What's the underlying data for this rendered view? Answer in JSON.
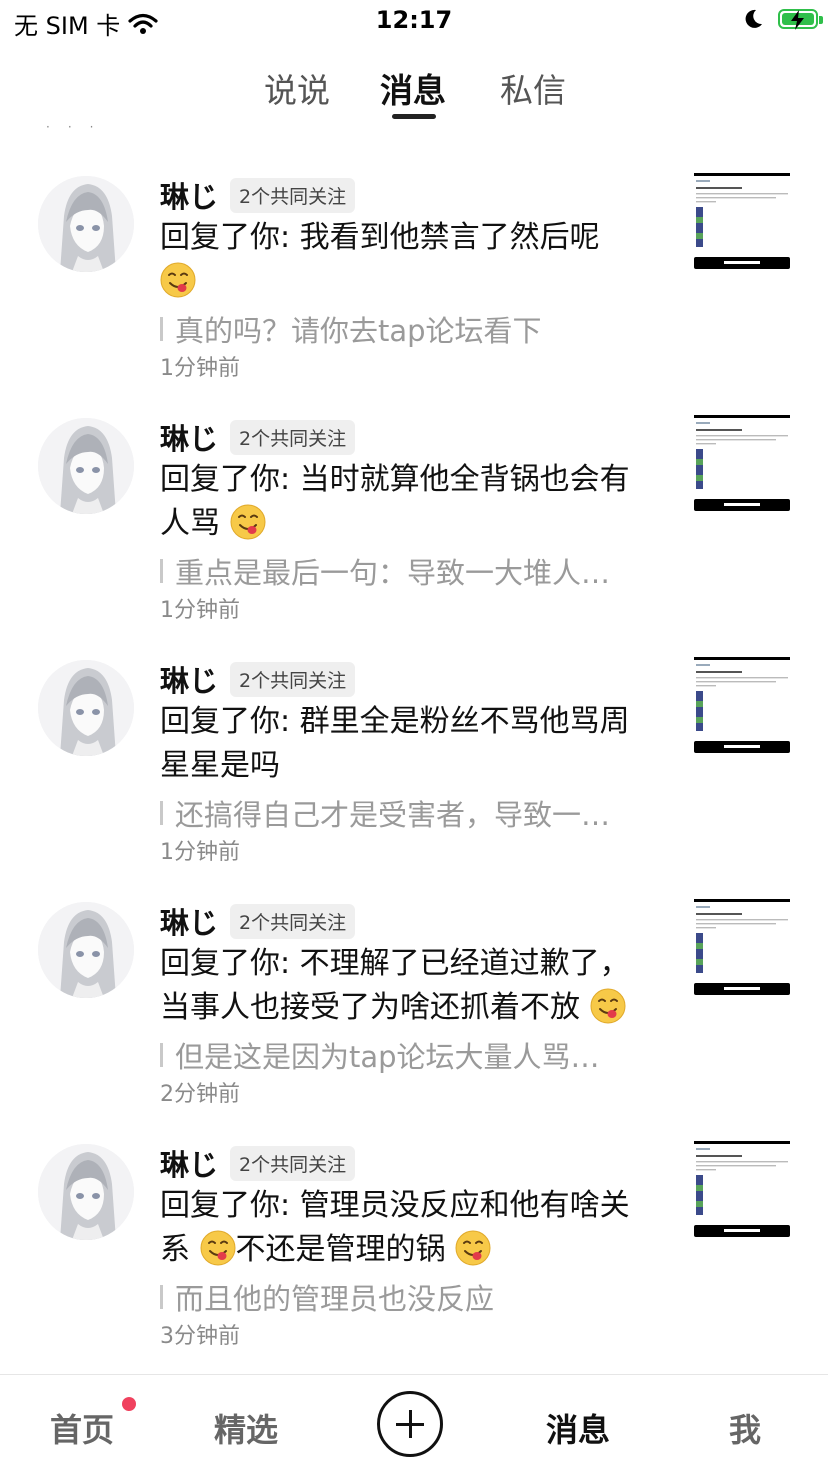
{
  "status_bar": {
    "carrier": "无 SIM 卡",
    "time": "12:17"
  },
  "top_tabs": [
    {
      "label": "说说",
      "active": false
    },
    {
      "label": "消息",
      "active": true
    },
    {
      "label": "私信",
      "active": false
    }
  ],
  "messages": [
    {
      "name": "琳じ",
      "badge": "2个共同关注",
      "segments": [
        {
          "t": "回复了你: 我看到他禁言了然后呢"
        },
        {
          "e": "face-savoring-food"
        }
      ],
      "quote": "真的吗？请你去tap论坛看下",
      "time": "1分钟前"
    },
    {
      "name": "琳じ",
      "badge": "2个共同关注",
      "segments": [
        {
          "t": "回复了你: 当时就算他全背锅也会有人骂"
        },
        {
          "e": "face-savoring-food"
        }
      ],
      "quote": "重点是最后一句：导致一大堆人…",
      "time": "1分钟前"
    },
    {
      "name": "琳じ",
      "badge": "2个共同关注",
      "segments": [
        {
          "t": "回复了你: 群里全是粉丝不骂他骂周星星是吗"
        }
      ],
      "quote": "还搞得自己才是受害者，导致一…",
      "time": "1分钟前"
    },
    {
      "name": "琳じ",
      "badge": "2个共同关注",
      "segments": [
        {
          "t": "回复了你: 不理解了已经道过歉了，当事人也接受了为啥还抓着不放"
        },
        {
          "e": "face-savoring-food"
        }
      ],
      "quote": "但是这是因为tap论坛大量人骂…",
      "time": "2分钟前"
    },
    {
      "name": "琳じ",
      "badge": "2个共同关注",
      "segments": [
        {
          "t": "回复了你: 管理员没反应和他有啥关系"
        },
        {
          "e": "face-savoring-food"
        },
        {
          "t": "不还是管理的锅"
        },
        {
          "e": "face-savoring-food"
        }
      ],
      "quote": "而且他的管理员也没反应",
      "time": "3分钟前"
    }
  ],
  "bottom_nav": [
    {
      "label": "首页",
      "active": false,
      "has_dot": true
    },
    {
      "label": "精选",
      "active": false
    },
    {
      "label": "消息",
      "active": true
    },
    {
      "label": "我",
      "active": false
    }
  ],
  "colors": {
    "notification_dot": "#f0415e",
    "battery": "#2fbf4a"
  }
}
